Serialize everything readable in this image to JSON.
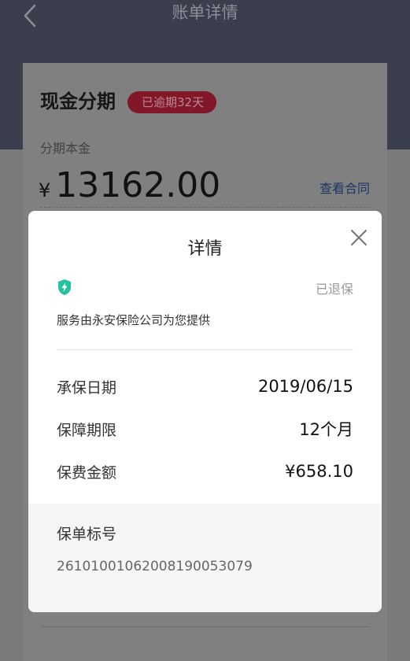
{
  "header": {
    "title": "账单详情"
  },
  "card": {
    "title": "现金分期",
    "badge": "已逾期32天",
    "principal_label": "分期本金",
    "currency_symbol": "¥",
    "amount": "13162.00",
    "contract_link": "查看合同"
  },
  "modal": {
    "title": "详情",
    "status": "已退保",
    "provider": "服务由永安保险公司为您提供",
    "rows": [
      {
        "label": "承保日期",
        "value": "2019/06/15"
      },
      {
        "label": "保障期限",
        "value": "12个月"
      },
      {
        "label": "保费金额",
        "value": "¥658.10"
      }
    ],
    "policy_label": "保单标号",
    "policy_number": "26101001062008190053079"
  },
  "icons": {
    "back": "chevron-left-icon",
    "close": "close-icon",
    "shield": "shield-lightning-icon"
  },
  "colors": {
    "header_bg": "#3b3f4d",
    "badge_bg": "#e7344f",
    "link": "#3a6ed8",
    "shield": "#24c3a0"
  }
}
